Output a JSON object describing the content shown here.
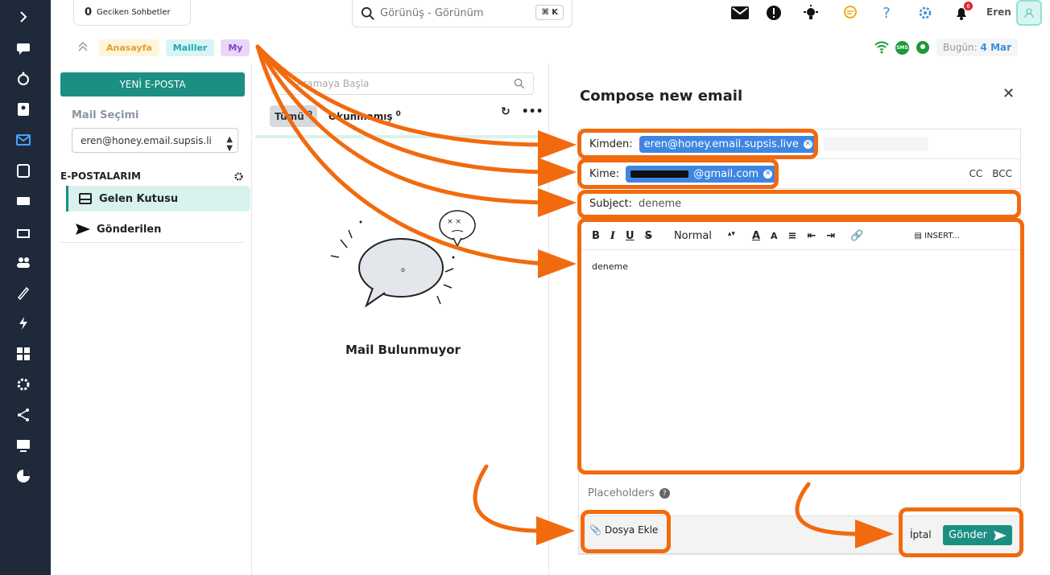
{
  "topbar": {
    "late_count": "0",
    "late_label": "Geciken Sohbetler",
    "search_placeholder": "Görünüş - Görünüm",
    "search_shortcut": "⌘ K",
    "user_name": "Eren",
    "notification_count": "6"
  },
  "breadcrumbs": [
    "Anasayfa",
    "Mailler",
    "My"
  ],
  "status": {
    "today_label": "Bugün:",
    "today_date": "4 Mar",
    "sms_label": "SMS"
  },
  "left": {
    "new_mail": "YENİ E-POSTA",
    "mail_select_label": "Mail Seçimi",
    "mail_select_value": "eren@honey.email.supsis.li",
    "my_mails": "E-POSTALARIM",
    "folders": [
      "Gelen Kutusu",
      "Gönderilen"
    ]
  },
  "list": {
    "search_placeholder": "Aramaya Başla",
    "tab_all": "Tümü",
    "tab_all_count": "0",
    "tab_unread": "Okunmamış",
    "tab_unread_count": "0",
    "empty_text": "Mail Bulunmuyor"
  },
  "compose": {
    "title": "Compose new email",
    "from_label": "Kimden:",
    "from_value": "eren@honey.email.supsis.live",
    "to_label": "Kime:",
    "to_value": "@gmail.com",
    "cc": "CC",
    "bcc": "BCC",
    "subject_label": "Subject:",
    "subject_value": "deneme",
    "toolbar_format": "Normal",
    "toolbar_insert": "INSERT...",
    "body": "deneme",
    "placeholders": "Placeholders",
    "attach": "Dosya Ekle",
    "cancel": "İptal",
    "send": "Gönder"
  },
  "colors": {
    "accent": "#1b8f82",
    "annotation": "#f26a0e",
    "chip": "#3f86e2",
    "sidebar": "#1e2a3a"
  }
}
